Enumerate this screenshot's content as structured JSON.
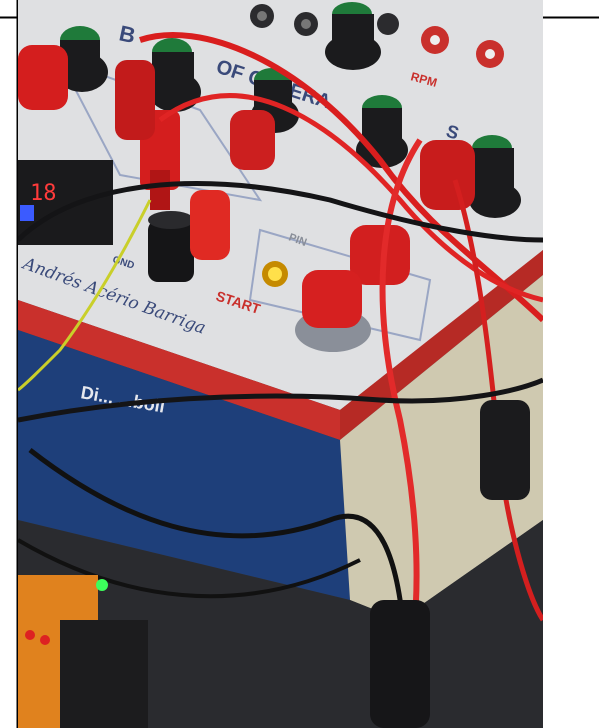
{
  "photo": {
    "panel_labels": {
      "title_partial": "B",
      "subtitle_partial": "OF GENERA",
      "subtitle_partial_2": "S",
      "rpm": "RPM",
      "pin": "PIN",
      "start": "START",
      "gnd": "GND",
      "author": "Andrés Acério Barriga",
      "box_label": "Di... ...boil"
    },
    "display": {
      "digits": "18"
    }
  }
}
